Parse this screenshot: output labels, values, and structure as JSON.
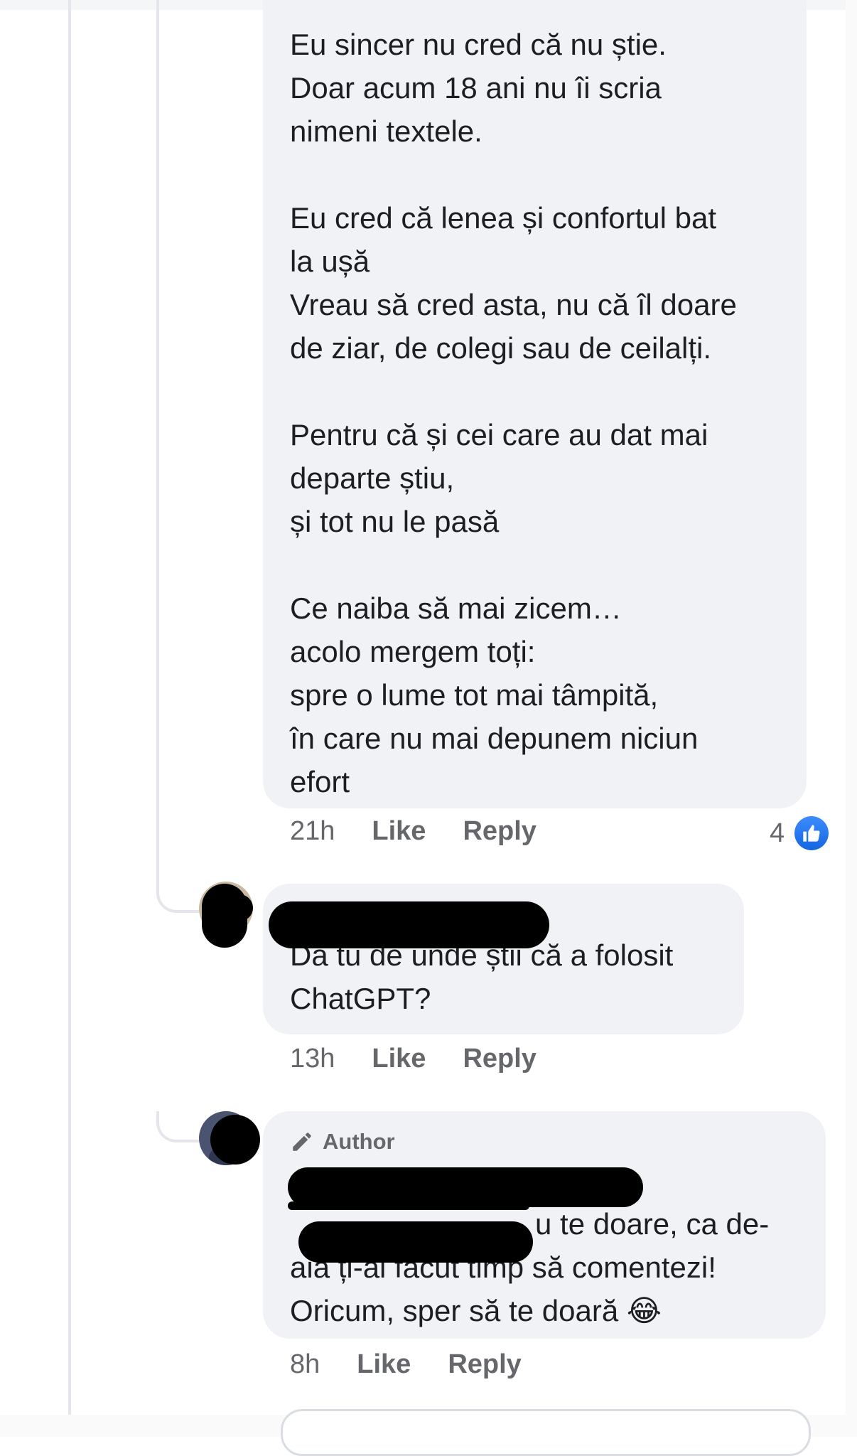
{
  "comments": [
    {
      "paragraphs": [
        [
          "Eu sincer nu cred că nu știe.",
          "Doar acum 18 ani nu îi scria",
          "nimeni textele."
        ],
        [
          "Eu cred că lenea și confortul bat",
          "la ușă",
          "Vreau să cred asta, nu că îl doare",
          "de ziar, de colegi sau de ceilalți."
        ],
        [
          "Pentru că și cei care au dat mai",
          "departe știu,",
          "și tot nu le pasă"
        ],
        [
          "Ce naiba să mai zicem…",
          "acolo mergem toți:",
          "spre o lume tot mai tâmpită,",
          "în care nu mai depunem niciun",
          "efort"
        ]
      ],
      "time": "21h",
      "like_label": "Like",
      "reply_label": "Reply",
      "reaction_count": "4",
      "reaction_icon": "like-thumbs-up-icon"
    },
    {
      "lines": [
        "Da tu de unde știi că a folosit",
        "ChatGPT?"
      ],
      "time": "13h",
      "like_label": "Like",
      "reply_label": "Reply"
    },
    {
      "badge": "Author",
      "badge_icon": "pencil-icon",
      "lines": [
        "u te doare, ca de-",
        "aia ți-ai făcut timp să comentezi!",
        "Oricum, sper să te doară 😂"
      ],
      "time": "8h",
      "like_label": "Like",
      "reply_label": "Reply"
    }
  ],
  "colors": {
    "bubble": "#f0f2f5",
    "meta_text": "#65676b",
    "link": "#216fdb",
    "like_badge": "#1877f2",
    "redaction": "#000000"
  }
}
